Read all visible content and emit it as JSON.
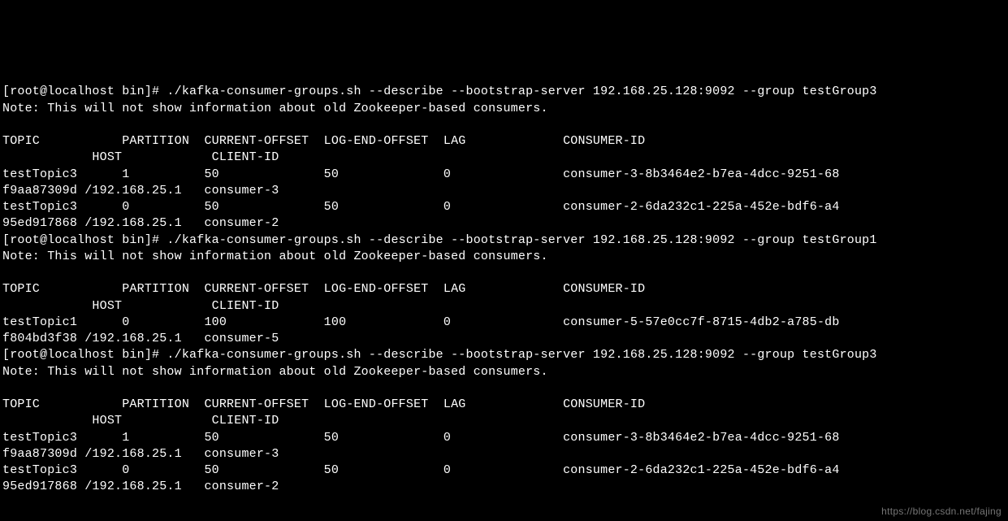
{
  "blocks": [
    {
      "prompt": "[root@localhost bin]# ",
      "command": "./kafka-consumer-groups.sh --describe --bootstrap-server 192.168.25.128:9092 --group testGroup3",
      "note": "Note: This will not show information about old Zookeeper-based consumers.",
      "header1": "TOPIC           PARTITION  CURRENT-OFFSET  LOG-END-OFFSET  LAG             CONSUMER-ID",
      "header2": "            HOST            CLIENT-ID",
      "rows": [
        {
          "line1": "testTopic3      1          50              50              0               consumer-3-8b3464e2-b7ea-4dcc-9251-68",
          "line2": "f9aa87309d /192.168.25.1   consumer-3"
        },
        {
          "line1": "testTopic3      0          50              50              0               consumer-2-6da232c1-225a-452e-bdf6-a4",
          "line2": "95ed917868 /192.168.25.1   consumer-2"
        }
      ]
    },
    {
      "prompt": "[root@localhost bin]# ",
      "command": "./kafka-consumer-groups.sh --describe --bootstrap-server 192.168.25.128:9092 --group testGroup1",
      "note": "Note: This will not show information about old Zookeeper-based consumers.",
      "header1": "TOPIC           PARTITION  CURRENT-OFFSET  LOG-END-OFFSET  LAG             CONSUMER-ID",
      "header2": "            HOST            CLIENT-ID",
      "rows": [
        {
          "line1": "testTopic1      0          100             100             0               consumer-5-57e0cc7f-8715-4db2-a785-db",
          "line2": "f804bd3f38 /192.168.25.1   consumer-5"
        }
      ]
    },
    {
      "prompt": "[root@localhost bin]# ",
      "command": "./kafka-consumer-groups.sh --describe --bootstrap-server 192.168.25.128:9092 --group testGroup3",
      "note": "Note: This will not show information about old Zookeeper-based consumers.",
      "header1": "TOPIC           PARTITION  CURRENT-OFFSET  LOG-END-OFFSET  LAG             CONSUMER-ID",
      "header2": "            HOST            CLIENT-ID",
      "rows": [
        {
          "line1": "testTopic3      1          50              50              0               consumer-3-8b3464e2-b7ea-4dcc-9251-68",
          "line2": "f9aa87309d /192.168.25.1   consumer-3"
        },
        {
          "line1": "testTopic3      0          50              50              0               consumer-2-6da232c1-225a-452e-bdf6-a4",
          "line2": "95ed917868 /192.168.25.1   consumer-2"
        }
      ]
    }
  ],
  "watermark": "https://blog.csdn.net/fajing"
}
